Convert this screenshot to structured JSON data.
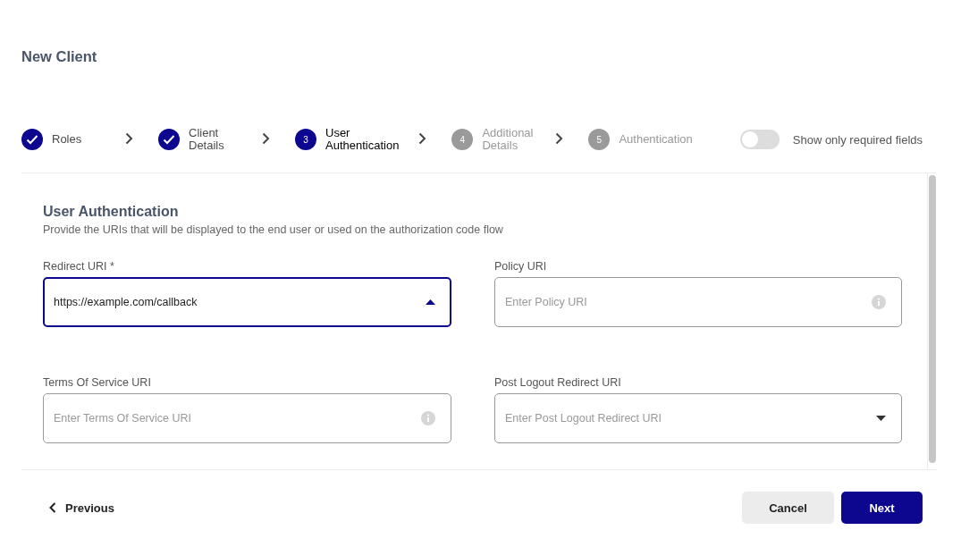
{
  "page": {
    "title": "New Client"
  },
  "steps": [
    {
      "label": "Roles",
      "completed": true,
      "selected": false
    },
    {
      "label": "Client Details",
      "completed": true,
      "selected": false
    },
    {
      "number": "3",
      "label": "User Authentication",
      "completed": false,
      "selected": true
    },
    {
      "number": "4",
      "label": "Additional Details",
      "completed": false,
      "selected": false
    },
    {
      "number": "5",
      "label": "Authentication",
      "completed": false,
      "selected": false
    }
  ],
  "required_toggle": {
    "label": "Show only required fields",
    "on": false
  },
  "section": {
    "title": "User Authentication",
    "description": "Provide the URIs that will be displayed to the end user or used on the authorization code flow"
  },
  "fields": [
    {
      "label": "Redirect URI *",
      "value": "https://example.com/callback",
      "focused": true,
      "kind": "dropdown",
      "expanded": true
    },
    {
      "label": "Policy URI",
      "placeholder": "Enter Policy URI",
      "focused": false,
      "kind": "info"
    },
    {
      "label": "Terms Of Service URI",
      "placeholder": "Enter Terms Of Service URI",
      "focused": false,
      "kind": "info"
    },
    {
      "label": "Post Logout Redirect URI",
      "placeholder": "Enter Post Logout Redirect URI",
      "focused": false,
      "kind": "dropdown",
      "expanded": false
    }
  ],
  "footer": {
    "previous": "Previous",
    "cancel": "Cancel",
    "next": "Next"
  }
}
